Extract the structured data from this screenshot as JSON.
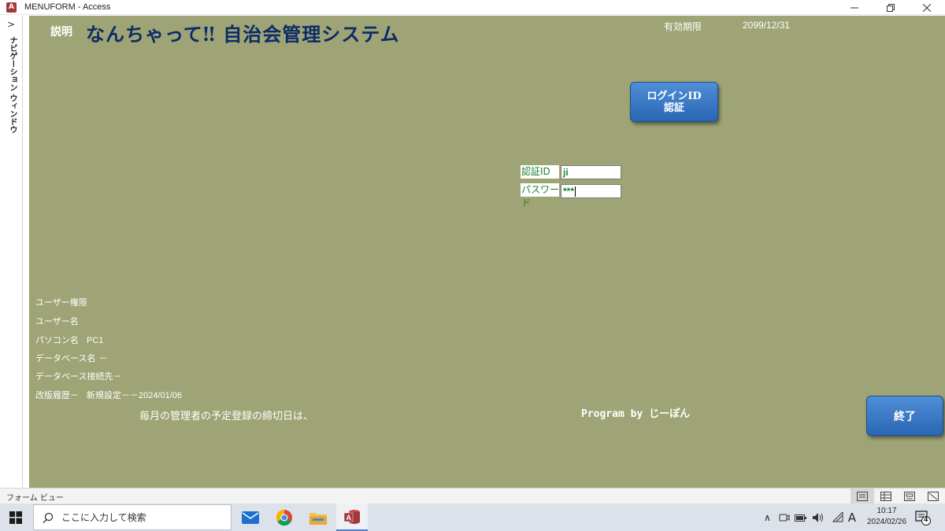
{
  "window": {
    "icon_letter": "A",
    "title": "MENUFORM - Access"
  },
  "nav_pane": {
    "label": "ナビゲーション ウィンドウ"
  },
  "form": {
    "setsumei_label": "説明",
    "app_title": "なんちゃって‼ 自治会管理システム",
    "expiry_label": "有効期限",
    "expiry_value": "2099/12/31",
    "login_button": {
      "line1": "ログインID",
      "line2": "認証"
    },
    "auth_id": {
      "label": "認証ID",
      "value": "ji"
    },
    "password": {
      "label": "パスワード",
      "value": "***"
    },
    "info": {
      "user_rights_label": "ユーザー権限",
      "user_rights_value": "",
      "user_name_label": "ユーザー名",
      "user_name_value": "",
      "pc_name_label": "パソコン名",
      "pc_name_value": "PC1",
      "db_name_label": "データベース名",
      "db_name_value": "－",
      "db_conn_label": "データベース接続先－",
      "history_label": "改版履歴－",
      "history_value": "新規設定－－2024/01/06"
    },
    "deadline_text": "毎月の管理者の予定登録の締切日は、",
    "program_by": "Program by じーぽん",
    "exit_button": "終了"
  },
  "statusbar": {
    "text": "フォーム ビュー"
  },
  "taskbar": {
    "search_placeholder": "ここに入力して検索",
    "apps": [
      "mail-icon",
      "chrome-icon",
      "file-explorer-icon",
      "access-icon"
    ],
    "ime_mode": "A",
    "time": "10:17",
    "date": "2024/02/26",
    "notification_count": "4"
  },
  "colors": {
    "form_background": "#9ea475",
    "title_text": "#0c2a66",
    "button_blue": "#2a66b4",
    "field_text_green": "#1f7f2f"
  }
}
